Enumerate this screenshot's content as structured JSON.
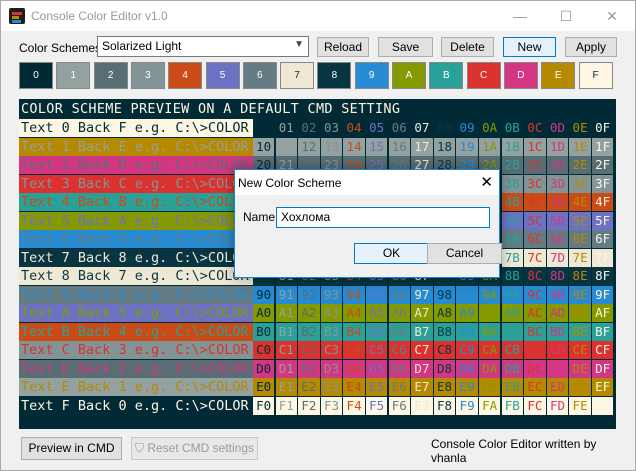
{
  "window": {
    "title": "Console Color Editor v1.0",
    "minimize": "—",
    "maximize": "☐",
    "close": "✕"
  },
  "toolbar": {
    "scheme_label": "Color Schemes:",
    "scheme_value": "Solarized Light",
    "buttons": {
      "reload": "Reload",
      "save": "Save",
      "delete": "Delete",
      "new": "New",
      "apply": "Apply"
    }
  },
  "palette": {
    "labels": [
      "0",
      "1",
      "2",
      "3",
      "4",
      "5",
      "6",
      "7",
      "8",
      "9",
      "A",
      "B",
      "C",
      "D",
      "E",
      "F"
    ],
    "colors": [
      "#002b36",
      "#93a1a1",
      "#586e75",
      "#839496",
      "#cb4b16",
      "#6c71c4",
      "#657b83",
      "#eee8d5",
      "#073642",
      "#268bd2",
      "#859900",
      "#2aa198",
      "#dc322f",
      "#d33682",
      "#b58900",
      "#fdf6e3"
    ]
  },
  "preview": {
    "header": "COLOR SCHEME PREVIEW ON A DEFAULT CMD SETTING",
    "rows": [
      {
        "text": "Text 0 Back F e.g. C:\\>COLOR",
        "fg": 0,
        "bg": 15
      },
      {
        "text": "Text 1 Back E e.g. C:\\>COLOR",
        "fg": 1,
        "bg": 14
      },
      {
        "text": "Text 2 Back D e.g. C:\\>COLOR",
        "fg": 2,
        "bg": 13
      },
      {
        "text": "Text 3 Back C e.g. C:\\>COLOR",
        "fg": 3,
        "bg": 12
      },
      {
        "text": "Text 4 Back B e.g. C:\\>COLOR",
        "fg": 4,
        "bg": 11
      },
      {
        "text": "Text 5 Back A e.g. C:\\>COLOR",
        "fg": 5,
        "bg": 10
      },
      {
        "text": "Text 6 Back 9 e.g. C:\\>COLOR",
        "fg": 6,
        "bg": 9
      },
      {
        "text": "Text 7 Back 8 e.g. C:\\>COLOR",
        "fg": 7,
        "bg": 8
      },
      {
        "text": "Text 8 Back 7 e.g. C:\\>COLOR",
        "fg": 8,
        "bg": 7
      },
      {
        "text": "Text 9 Back 6 e.g. C:\\>COLOR",
        "fg": 9,
        "bg": 6
      },
      {
        "text": "Text A Back 5 e.g. C:\\>COLOR",
        "fg": 10,
        "bg": 5
      },
      {
        "text": "Text B Back 4 e.g. C:\\>COLOR",
        "fg": 11,
        "bg": 4
      },
      {
        "text": "Text C Back 3 e.g. C:\\>COLOR",
        "fg": 12,
        "bg": 3
      },
      {
        "text": "Text D Back 2 e.g. C:\\>COLOR",
        "fg": 13,
        "bg": 2
      },
      {
        "text": "Text E Back 1 e.g. C:\\>COLOR",
        "fg": 14,
        "bg": 1
      },
      {
        "text": "Text F Back 0 e.g. C:\\>COLOR",
        "fg": 15,
        "bg": 0
      }
    ]
  },
  "bottom": {
    "preview_cmd": "Preview in CMD",
    "reset_cmd": "Reset CMD settings",
    "credit": "Console Color Editor written by vhanla"
  },
  "dialog": {
    "title": "New Color Scheme",
    "name_label": "Name",
    "name_value": "Хохлома",
    "ok": "OK",
    "cancel": "Cancel",
    "close": "✕"
  }
}
